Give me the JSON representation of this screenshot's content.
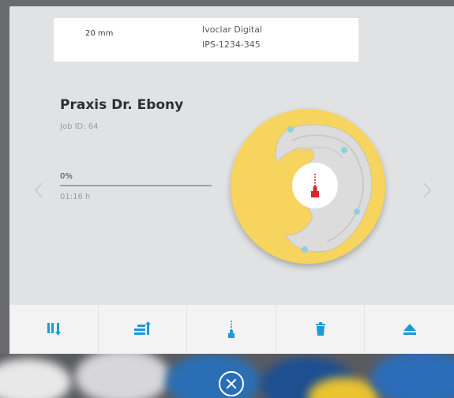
{
  "info": {
    "size": "20 mm",
    "brand": "Ivoclar Digital",
    "code": "IPS-1234-345"
  },
  "job": {
    "title": "Praxis Dr. Ebony",
    "id_label": "Job ID: 64",
    "progress_text": "0%",
    "progress_value": 0,
    "duration": "01:16 h"
  },
  "nav": {
    "prev_icon": "chevron-left-icon",
    "next_icon": "chevron-right-icon"
  },
  "disc": {
    "color": "#f6d45d",
    "center_icon": "milling-tool-icon",
    "accent": "#d32a2a"
  },
  "toolbar": {
    "accent": "#1b9ad6",
    "items": [
      {
        "icon": "sort-down-icon"
      },
      {
        "icon": "transfer-icon"
      },
      {
        "icon": "milling-tool-icon"
      },
      {
        "icon": "trash-icon"
      },
      {
        "icon": "eject-icon"
      }
    ]
  },
  "overlay": {
    "close_icon": "close-circle-icon"
  }
}
